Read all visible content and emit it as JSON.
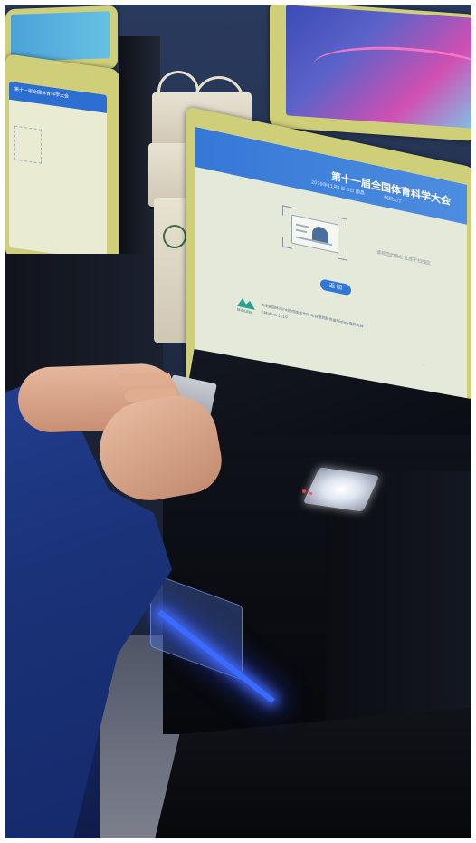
{
  "scene": {
    "description_kind": "photo of people using ID registration kiosks"
  },
  "kiosk_left": {
    "title": "第十一届全国体育科学大会",
    "subtitle": "..."
  },
  "main_kiosk": {
    "header_title": "第十一届全国体育科学大会",
    "header_item_1": "2019年11月1日-3日 南昌",
    "header_item_2": "报到大厅",
    "hint_text": "请将您的身份证放于扫描区",
    "button_label": "返 回",
    "logo_text": "MIDLINK",
    "footer_line_1": "本设备由Midlink提供技术支持 本会报到服务由Midlink提供支持",
    "footer_line_2": "©Midlink 2019",
    "footer_line_3": "..."
  },
  "colors": {
    "screen_header": "#3578d6",
    "bezel": "#cfcf7a",
    "led_strip": "#3a6bff",
    "sleeve": "#1a3278"
  }
}
